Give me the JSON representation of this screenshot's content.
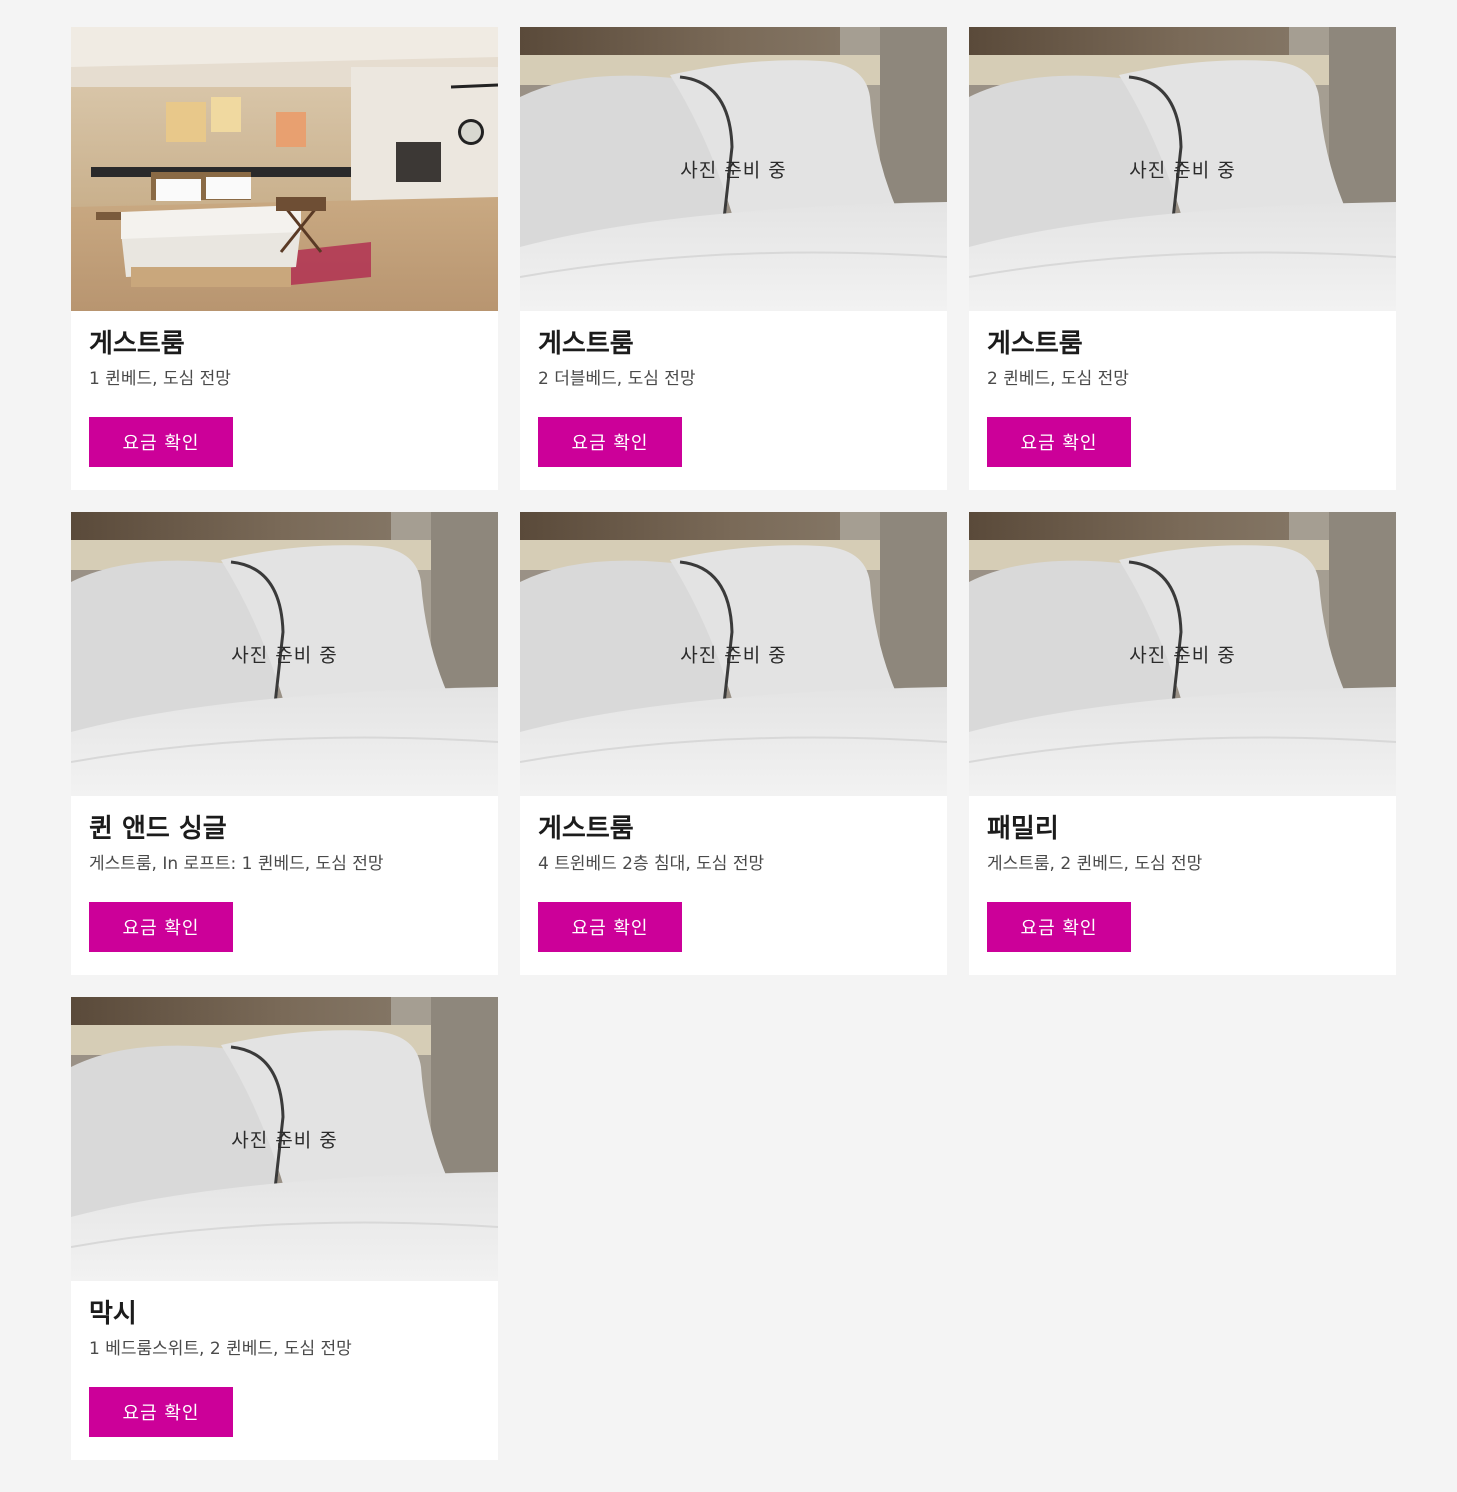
{
  "rooms": [
    {
      "title": "게스트룸",
      "description": "1 퀸베드, 도심 전망",
      "photo_label": "",
      "has_photo": true,
      "button_label": "요금 확인"
    },
    {
      "title": "게스트룸",
      "description": "2 더블베드, 도심 전망",
      "photo_label": "사진 준비 중",
      "has_photo": false,
      "button_label": "요금 확인"
    },
    {
      "title": "게스트룸",
      "description": "2 퀸베드, 도심 전망",
      "photo_label": "사진 준비 중",
      "has_photo": false,
      "button_label": "요금 확인"
    },
    {
      "title": "퀸 앤드 싱글",
      "description": "게스트룸, In 로프트: 1 퀸베드, 도심 전망",
      "photo_label": "사진 준비 중",
      "has_photo": false,
      "button_label": "요금 확인"
    },
    {
      "title": "게스트룸",
      "description": "4 트윈베드 2층 침대, 도심 전망",
      "photo_label": "사진 준비 중",
      "has_photo": false,
      "button_label": "요금 확인"
    },
    {
      "title": "패밀리",
      "description": "게스트룸, 2 퀸베드, 도심 전망",
      "photo_label": "사진 준비 중",
      "has_photo": false,
      "button_label": "요금 확인"
    },
    {
      "title": "막시",
      "description": "1 베드룸스위트, 2 퀸베드, 도심 전망",
      "photo_label": "사진 준비 중",
      "has_photo": false,
      "button_label": "요금 확인"
    }
  ],
  "colors": {
    "accent": "#cc0099",
    "page_background": "#f4f4f4",
    "card_background": "#ffffff"
  }
}
